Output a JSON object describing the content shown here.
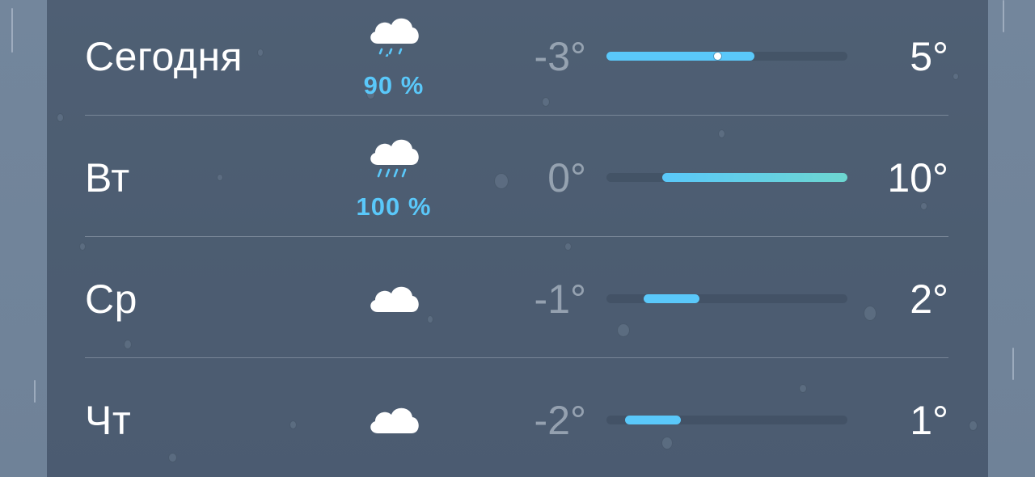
{
  "forecast": {
    "range_min": -3,
    "range_max": 10,
    "current_temp": 3,
    "rows": [
      {
        "day": "Сегодня",
        "icon": "cloud-drizzle-icon",
        "precip": "90 %",
        "low_text": "-3°",
        "high_text": "5°",
        "low": -3,
        "high": 5,
        "show_current": true,
        "bar_colors": [
          "#5ac8fa",
          "#5ac8fa"
        ]
      },
      {
        "day": "Вт",
        "icon": "cloud-rain-icon",
        "precip": "100 %",
        "low_text": "0°",
        "high_text": "10°",
        "low": 0,
        "high": 10,
        "show_current": false,
        "bar_colors": [
          "#5ac8fa",
          "#6dd6d0"
        ]
      },
      {
        "day": "Ср",
        "icon": "cloud-icon",
        "precip": "",
        "low_text": "-1°",
        "high_text": "2°",
        "low": -1,
        "high": 2,
        "show_current": false,
        "bar_colors": [
          "#5ac8fa",
          "#5ac8fa"
        ]
      },
      {
        "day": "Чт",
        "icon": "cloud-icon",
        "precip": "",
        "low_text": "-2°",
        "high_text": "1°",
        "low": -2,
        "high": 1,
        "show_current": false,
        "bar_colors": [
          "#5ac8fa",
          "#5ac8fa"
        ]
      }
    ]
  },
  "colors": {
    "precip_blue": "#5ac8fa",
    "text_primary": "#ffffff"
  }
}
